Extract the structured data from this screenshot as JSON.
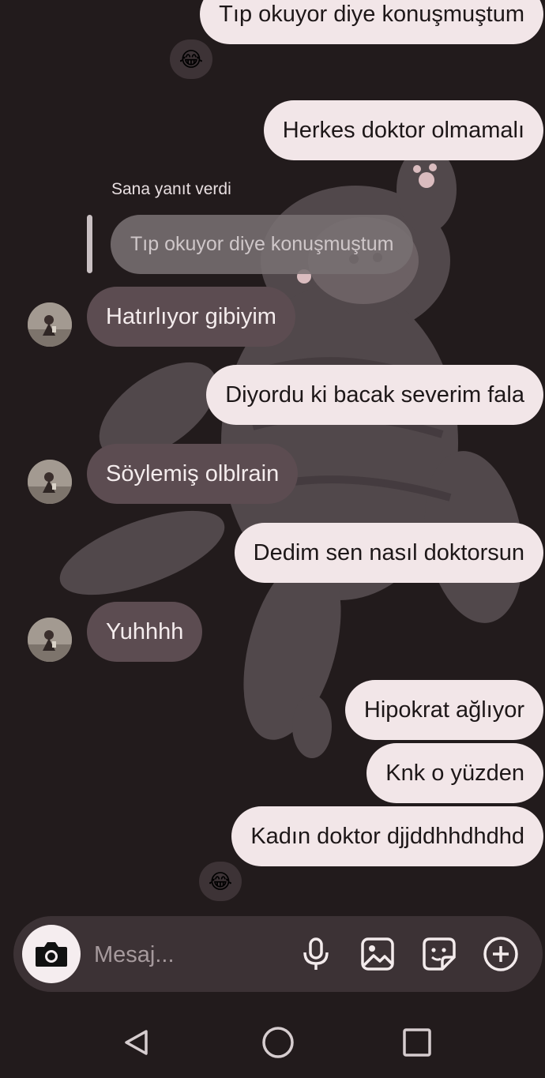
{
  "wallpaper": {
    "icon": "cat-wallpaper"
  },
  "messages": [
    {
      "side": "outgoing",
      "text": "Tıp okuyor diye konuşmuştum",
      "reaction": "😂"
    },
    {
      "side": "outgoing",
      "text": "Herkes doktor olmamalı"
    },
    {
      "reply": {
        "label": "Sana yanıt verdi",
        "quoted": "Tıp okuyor diye konuşmuştum"
      }
    },
    {
      "side": "incoming",
      "text": "Hatırlıyor gibiyim"
    },
    {
      "side": "outgoing",
      "text": "Diyordu ki bacak severim fala"
    },
    {
      "side": "incoming",
      "text": "Söylemiş olblrain"
    },
    {
      "side": "outgoing",
      "text": "Dedim sen nasıl doktorsun"
    },
    {
      "side": "incoming",
      "text": "Yuhhhh"
    },
    {
      "side": "outgoing",
      "text": "Hipokrat ağlıyor"
    },
    {
      "side": "outgoing",
      "text": "Knk o yüzden"
    },
    {
      "side": "outgoing",
      "text": "Kadın doktor djjddhhdhdhd",
      "reaction": "😂"
    }
  ],
  "composer": {
    "placeholder": "Mesaj...",
    "icons": [
      "camera-icon",
      "microphone-icon",
      "gallery-icon",
      "sticker-icon",
      "plus-icon"
    ]
  },
  "navbar": {
    "icons": [
      "back-icon",
      "home-icon",
      "recents-icon"
    ]
  },
  "colors": {
    "background": "#221b1c",
    "outgoing_bubble": "#f2e6e8",
    "incoming_bubble": "#5c4c51",
    "composer": "#3c3235"
  }
}
